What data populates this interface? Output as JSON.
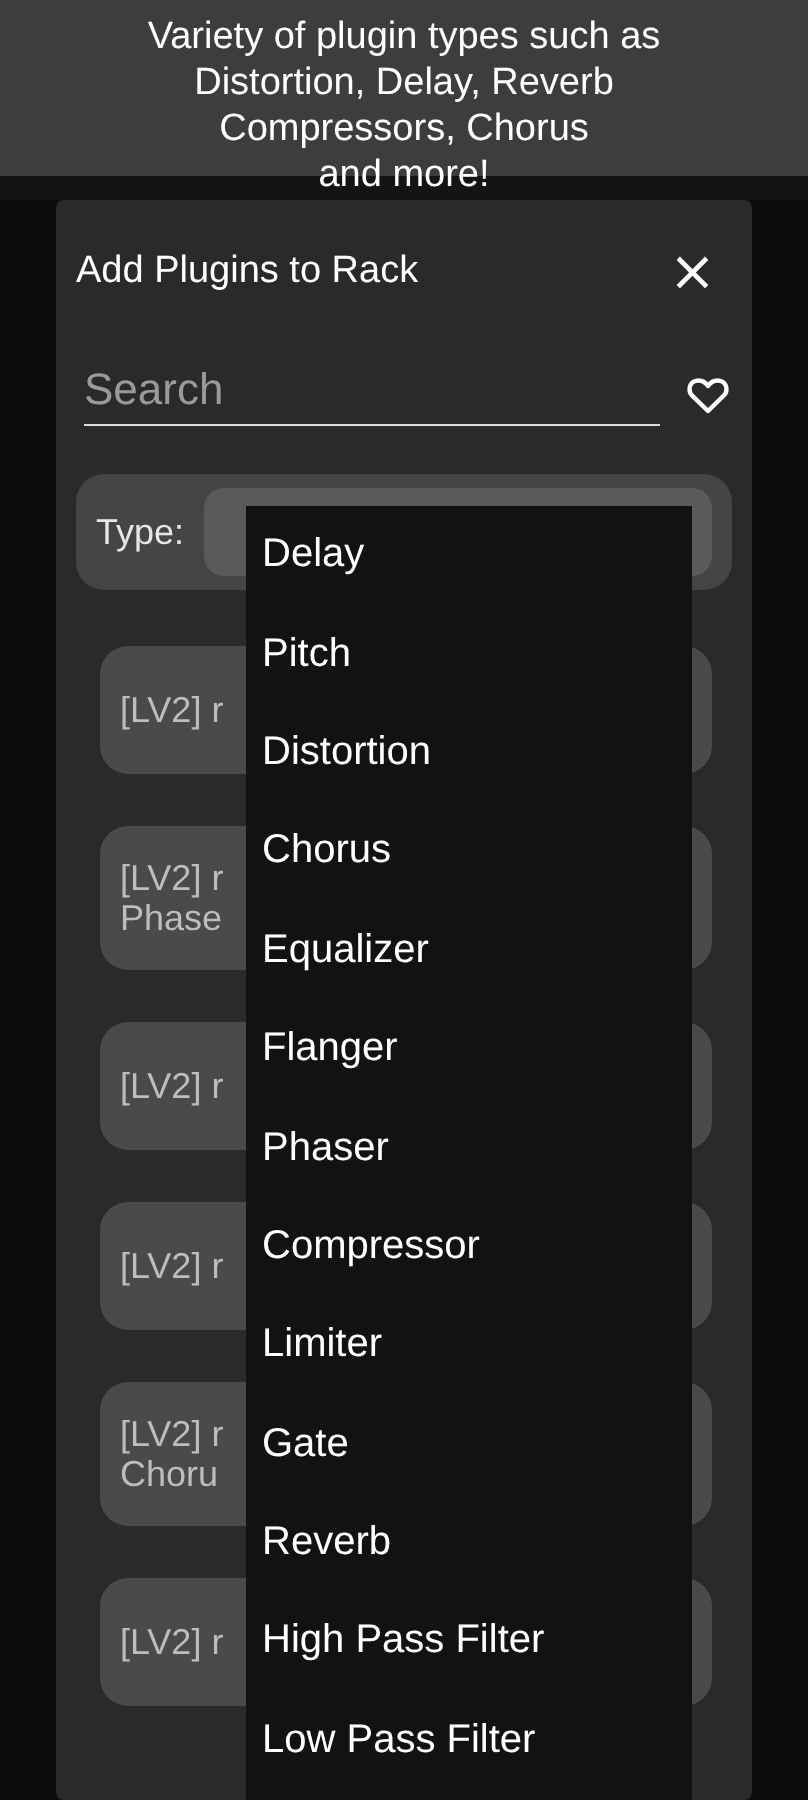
{
  "caption": "Variety of plugin types such as\nDistortion, Delay, Reverb\nCompressors, Chorus\nand more!",
  "dialog": {
    "title": "Add Plugins to Rack",
    "close": "×"
  },
  "search": {
    "placeholder": "Search"
  },
  "type_filter": {
    "label": "Type:"
  },
  "plugins": [
    {
      "lines": [
        "[LV2] r"
      ]
    },
    {
      "lines": [
        "[LV2] r",
        "Phase"
      ]
    },
    {
      "lines": [
        "[LV2] r"
      ]
    },
    {
      "lines": [
        "[LV2] r"
      ]
    },
    {
      "lines": [
        "[LV2] r",
        "Choru"
      ]
    },
    {
      "lines": [
        "[LV2] r"
      ]
    }
  ],
  "type_menu": {
    "items": [
      "Delay",
      "Pitch",
      "Distortion",
      "Chorus",
      "Equalizer",
      "Flanger",
      "Phaser",
      "Compressor",
      "Limiter",
      "Gate",
      "Reverb",
      "High Pass Filter",
      "Low Pass Filter"
    ]
  }
}
